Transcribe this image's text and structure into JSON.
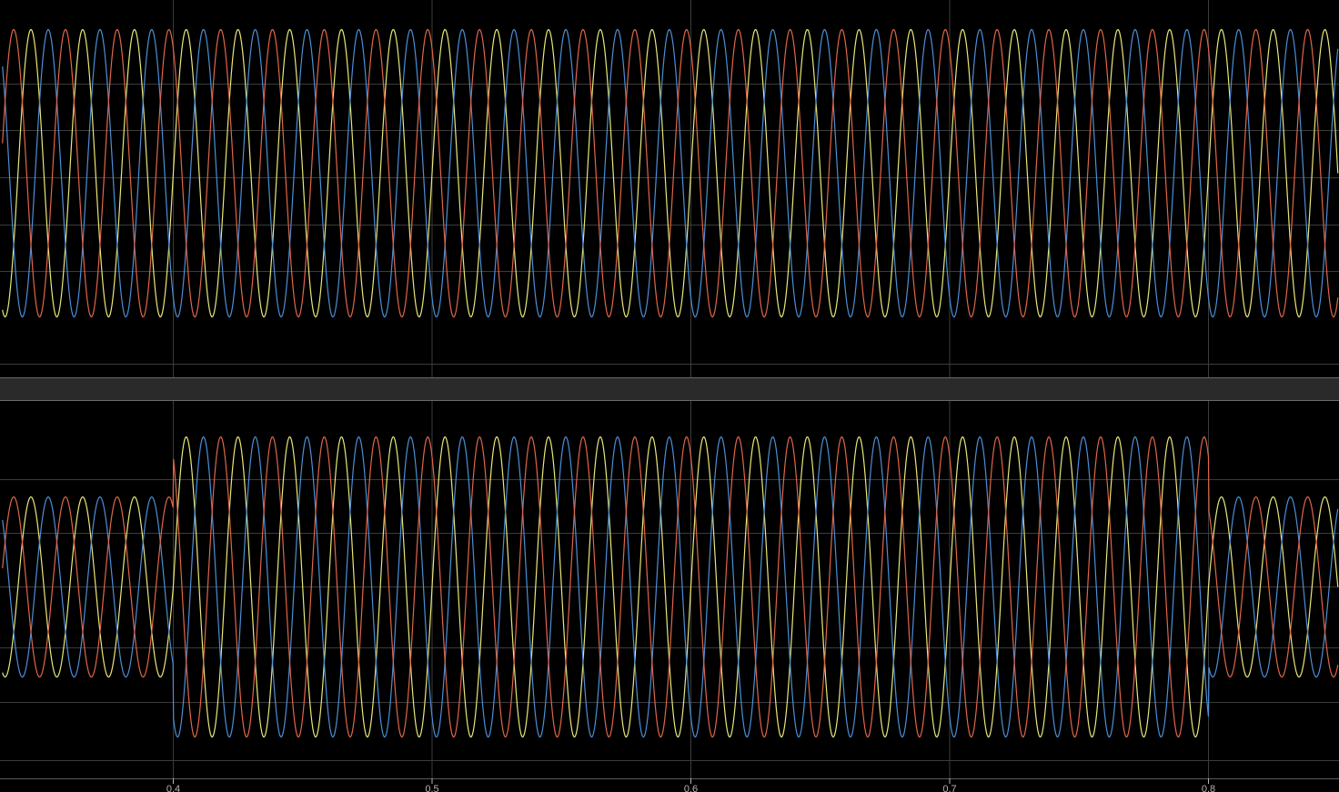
{
  "colors": {
    "background": "#000000",
    "grid": "#3c3c3c",
    "separator": "#2a2a2a",
    "separator_line": "#6a6a6a",
    "tick_text": "#b4b4b4",
    "phase_a": "#e8e87a",
    "phase_b": "#4c8fd6",
    "phase_c": "#e0664a"
  },
  "chart_data": [
    {
      "type": "line",
      "panel": "top",
      "x_range": [
        0.334,
        0.85
      ],
      "frequency_hz": 50,
      "grid": true,
      "series": [
        {
          "phase_deg": 0,
          "color": "#e8e87a"
        },
        {
          "phase_deg": -120,
          "color": "#4c8fd6"
        },
        {
          "phase_deg": 120,
          "color": "#e0664a"
        }
      ],
      "amplitude_segments": [
        {
          "t_start": 0.334,
          "t_end": 0.4,
          "amplitude": 1.0
        },
        {
          "t_start": 0.4,
          "t_end": 0.8,
          "amplitude": 1.0
        },
        {
          "t_start": 0.8,
          "t_end": 0.85,
          "amplitude": 1.0
        }
      ],
      "y_range": [
        -1.35,
        1.35
      ]
    },
    {
      "type": "line",
      "panel": "bottom",
      "x_range": [
        0.334,
        0.85
      ],
      "frequency_hz": 50,
      "grid": true,
      "series": [
        {
          "phase_deg": 0,
          "color": "#e8e87a"
        },
        {
          "phase_deg": -120,
          "color": "#4c8fd6"
        },
        {
          "phase_deg": 120,
          "color": "#e0664a"
        }
      ],
      "amplitude_segments": [
        {
          "t_start": 0.334,
          "t_end": 0.4,
          "amplitude": 0.6
        },
        {
          "t_start": 0.4,
          "t_end": 0.8,
          "amplitude": 1.0
        },
        {
          "t_start": 0.8,
          "t_end": 0.85,
          "amplitude": 0.6
        }
      ],
      "y_range": [
        -1.35,
        1.35
      ]
    }
  ],
  "x_ticks": [
    "0.4",
    "0.5",
    "0.6",
    "0.7",
    "0.8"
  ],
  "x_tick_values": [
    0.4,
    0.5,
    0.6,
    0.7,
    0.8
  ]
}
